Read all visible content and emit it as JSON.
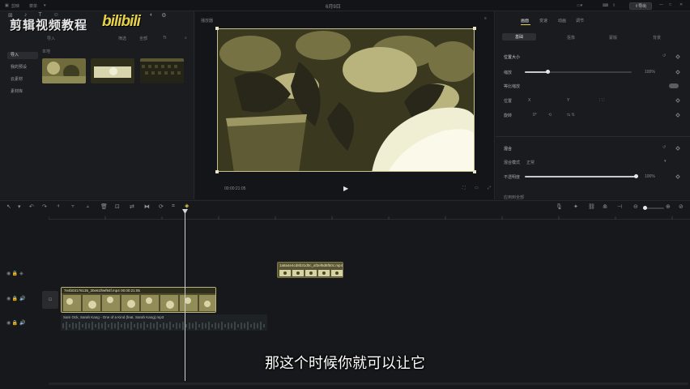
{
  "window": {
    "title": "6月9日",
    "menu": "菜单",
    "export": "导出"
  },
  "watermark": {
    "text": "剪辑视频教程",
    "logo": "bilibili"
  },
  "media_panel": {
    "tabs": [
      "媒体",
      "音频",
      "文本",
      "贴纸",
      "特效",
      "转场",
      "滤镜",
      "调节"
    ],
    "toolbar": [
      "导入",
      "筛选",
      "全部",
      "Tt"
    ],
    "nav": [
      "导入",
      "我的预设",
      "云素材",
      "素材库"
    ],
    "section": "本地"
  },
  "preview": {
    "title": "播放器",
    "timecode": "00:00:21:05"
  },
  "right_panel": {
    "tabs": [
      "画面",
      "变速",
      "动画",
      "调节"
    ],
    "subtabs": [
      "基础",
      "抠像",
      "蒙版",
      "背景"
    ],
    "position_section": "位置大小",
    "scale_label": "缩放",
    "scale_value": "100%",
    "uniform_label": "等比缩放",
    "pos_label": "位置",
    "rotate_label": "旋转",
    "rotate_value": "0°",
    "blend_section": "混合",
    "mode_label": "混合模式",
    "mode_value": "正常",
    "opacity_label": "不透明度",
    "opacity_value": "100%",
    "apply_all": "应用到全部"
  },
  "timeline": {
    "main_clip_label": "7e4b03176135_30e61f9ef84f.mp4  00:00:21:05",
    "small_clip_label": "1a8a4e4cd8b31d0c_af3ef6d6f50c.mp4",
    "audio_label": "Sam Ock, Sarah Kang - One of a Kind (feat. Sarah Kang).mp3"
  },
  "subtitle": "那这个时候你就可以让它",
  "colors": {
    "accent": "#e6d24a",
    "clip_border": "#b9b37d",
    "bg": "#18191c"
  }
}
